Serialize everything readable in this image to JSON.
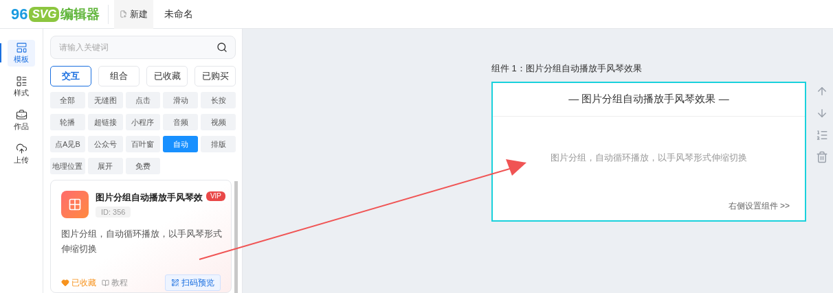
{
  "logo": {
    "number": "96",
    "badge": "SVG",
    "text": "编辑器"
  },
  "header": {
    "new_button": "新建",
    "document_title": "未命名"
  },
  "rail": [
    {
      "label": "模板",
      "selected": true
    },
    {
      "label": "样式",
      "selected": false
    },
    {
      "label": "作品",
      "selected": false
    },
    {
      "label": "上传",
      "selected": false
    }
  ],
  "search": {
    "placeholder": "请输入关键词"
  },
  "categories": [
    {
      "label": "交互",
      "selected": true
    },
    {
      "label": "组合",
      "selected": false
    },
    {
      "label": "已收藏",
      "selected": false
    },
    {
      "label": "已购买",
      "selected": false
    }
  ],
  "tags": [
    {
      "label": "全部",
      "selected": false
    },
    {
      "label": "无缝图",
      "selected": false
    },
    {
      "label": "点击",
      "selected": false
    },
    {
      "label": "滑动",
      "selected": false
    },
    {
      "label": "长按",
      "selected": false
    },
    {
      "label": "轮播",
      "selected": false
    },
    {
      "label": "超链接",
      "selected": false
    },
    {
      "label": "小程序",
      "selected": false
    },
    {
      "label": "音频",
      "selected": false
    },
    {
      "label": "视频",
      "selected": false
    },
    {
      "label": "点A见B",
      "selected": false
    },
    {
      "label": "公众号",
      "selected": false
    },
    {
      "label": "百叶窗",
      "selected": false
    },
    {
      "label": "自动",
      "selected": true
    },
    {
      "label": "排版",
      "selected": false
    },
    {
      "label": "地理位置",
      "selected": false
    },
    {
      "label": "展开",
      "selected": false
    },
    {
      "label": "免费",
      "selected": false
    }
  ],
  "template_card": {
    "title": "图片分组自动播放手风琴效",
    "badge": "VIP",
    "id": "ID: 356",
    "description": "图片分组，自动循环播放，以手风琴形式伸缩切换",
    "favorited": true,
    "favorite_label": "已收藏",
    "tutorial_label": "教程",
    "preview_button": "扫码预览"
  },
  "canvas": {
    "component_label": "组件 1：图片分组自动播放手风琴效果",
    "heading": "— 图片分组自动播放手风琴效果 —",
    "body": "图片分组，自动循环播放，以手风琴形式伸缩切换",
    "footer_link": "右侧设置组件 >>"
  }
}
